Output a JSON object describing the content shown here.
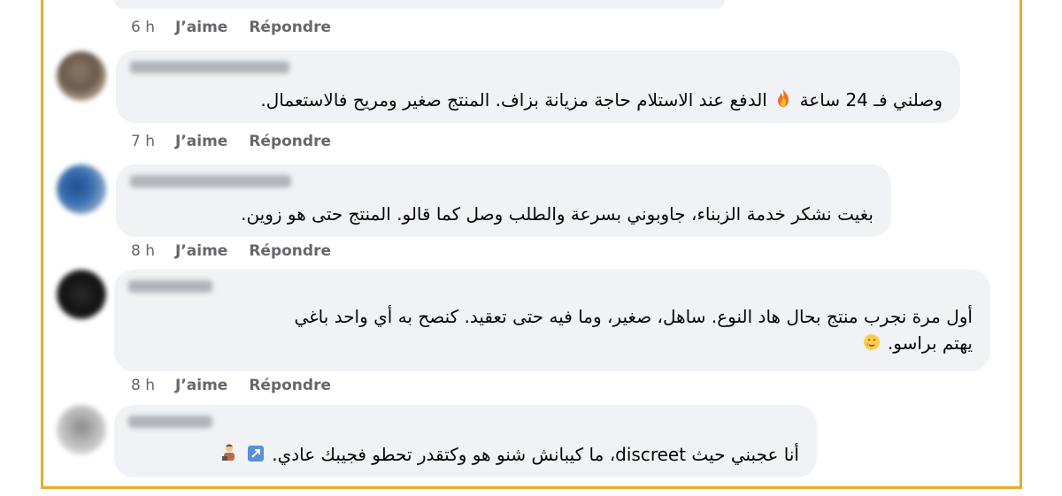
{
  "actions": {
    "like": "J’aime",
    "reply": "Répondre"
  },
  "previous": {
    "time": "6 h"
  },
  "comments": [
    {
      "time": "7 h",
      "text_before_emoji": "وصلني فـ 24 ساعة",
      "emoji": "fire-emoji",
      "text_after_emoji": "الدفع عند الاستلام حاجة مزيانة بزاف. المنتج صغير ومريح فالاستعمال."
    },
    {
      "time": "8 h",
      "text": "بغيت نشكر خدمة الزبناء، جاوبوني بسرعة والطلب وصل كما قالو. المنتج حتى هو زوين."
    },
    {
      "time": "8 h",
      "line1": "أول مرة نجرب منتج بحال هاد النوع. ساهل، صغير، وما فيه حتى تعقيد. كنصح به أي واحد باغي",
      "line2": "يهتم براسو.",
      "emoji": "smiling-tear-emoji"
    },
    {
      "text": "أنا عجبني حيث discreet، ما كيبانش شنو هو وكتقدر تحطو فجيبك عادي.",
      "emoji": [
        "arrow-box-emoji",
        "person-emoji"
      ]
    }
  ],
  "colors": {
    "frame": "#e5ad2a",
    "bubble": "#f0f2f5",
    "meta": "#65676b",
    "text": "#050505"
  }
}
